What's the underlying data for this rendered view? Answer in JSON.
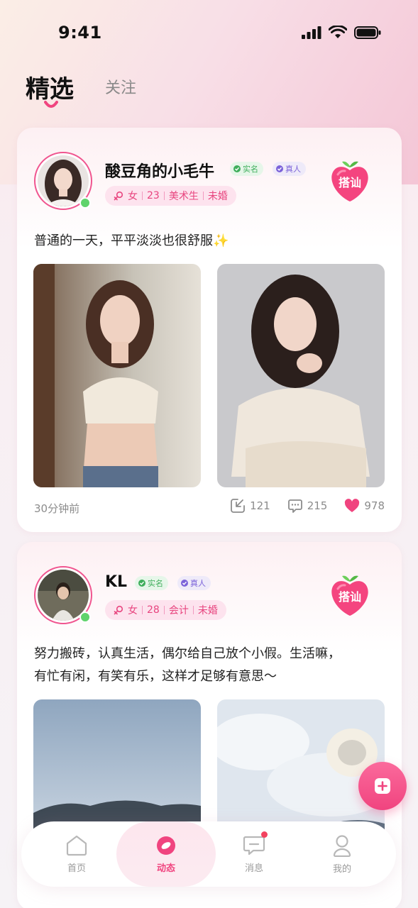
{
  "status_bar": {
    "time": "9:41"
  },
  "top_tabs": {
    "featured": "精选",
    "following": "关注"
  },
  "posts": [
    {
      "username": "酸豆角的小毛牛",
      "badge_real": "实名",
      "badge_verified": "真人",
      "gender": "女",
      "age": "23",
      "job": "美术生",
      "marital": "未婚",
      "flirt_label": "搭讪",
      "text": "普通的一天，平平淡淡也很舒服✨",
      "time": "30分钟前",
      "shares": "121",
      "comments": "215",
      "likes": "978"
    },
    {
      "username": "KL",
      "badge_real": "实名",
      "badge_verified": "真人",
      "gender": "女",
      "age": "28",
      "job": "会计",
      "marital": "未婚",
      "flirt_label": "搭讪",
      "text_line1": "努力搬砖，认真生活，偶尔给自己放个小假。生活嘛，",
      "text_line2": "有忙有闲，有笑有乐，这样才足够有意思～"
    }
  ],
  "tabbar": {
    "home": "首页",
    "feed": "动态",
    "messages": "消息",
    "me": "我的"
  },
  "colors": {
    "accent": "#f0447f",
    "online": "#5fd36b",
    "badge_real": "#3fae5b",
    "badge_verified": "#7b62d9"
  }
}
